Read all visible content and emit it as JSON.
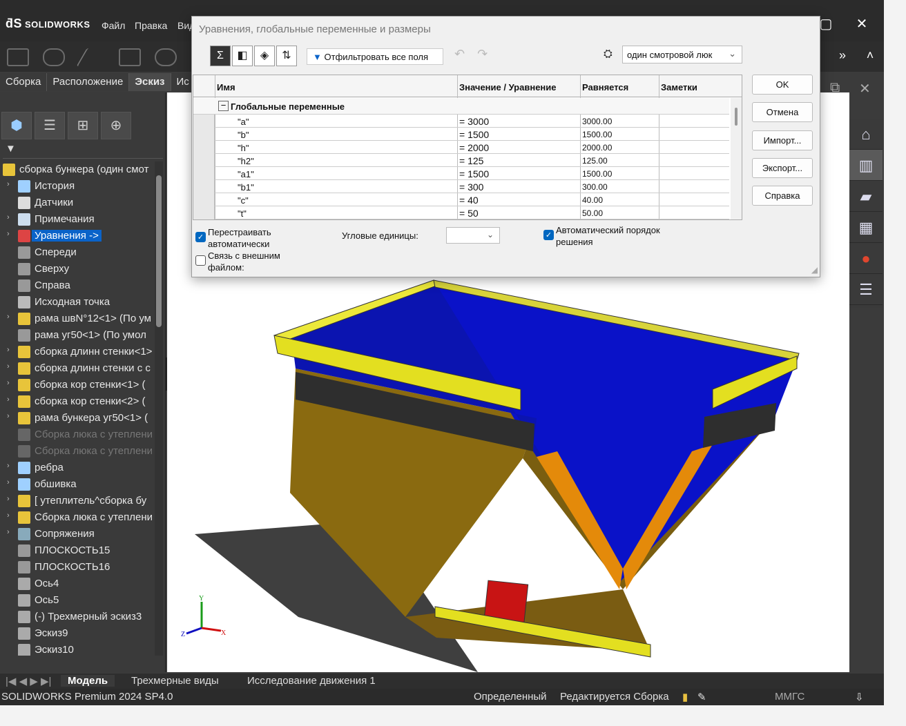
{
  "app": {
    "logo": "SOLIDWORKS",
    "menu": [
      "Файл",
      "Правка",
      "Вид"
    ],
    "tabs": [
      "Сборка",
      "Расположение",
      "Эскиз",
      "Ис"
    ],
    "active_tab": "Эскиз"
  },
  "tree": {
    "root": "сборка бункера (один смот",
    "items": [
      {
        "label": "История",
        "arrow": true,
        "icon": "history-icon"
      },
      {
        "label": "Датчики",
        "arrow": false,
        "icon": "sensor-icon"
      },
      {
        "label": "Примечания",
        "arrow": true,
        "icon": "annotation-icon"
      },
      {
        "label": "Уравнения ->",
        "arrow": true,
        "icon": "equation-icon",
        "selected": true
      },
      {
        "label": "Спереди",
        "arrow": false,
        "icon": "plane-icon"
      },
      {
        "label": "Сверху",
        "arrow": false,
        "icon": "plane-icon"
      },
      {
        "label": "Справа",
        "arrow": false,
        "icon": "plane-icon"
      },
      {
        "label": "Исходная точка",
        "arrow": false,
        "icon": "origin-icon"
      },
      {
        "label": "рама швN°12<1> (По ум",
        "arrow": true,
        "icon": "part-icon"
      },
      {
        "label": "рама уг50<1> (По умол",
        "arrow": false,
        "icon": "part-gray-icon"
      },
      {
        "label": "сборка длинн стенки<1>",
        "arrow": true,
        "icon": "assembly-icon"
      },
      {
        "label": "сборка длинн стенки с с",
        "arrow": true,
        "icon": "assembly-icon"
      },
      {
        "label": "сборка кор стенки<1> (",
        "arrow": true,
        "icon": "assembly-icon"
      },
      {
        "label": "сборка кор стенки<2> (",
        "arrow": true,
        "icon": "assembly-icon"
      },
      {
        "label": "рама бункера уг50<1> (",
        "arrow": true,
        "icon": "part-icon"
      },
      {
        "label": "Сборка люка с утеплени",
        "arrow": false,
        "icon": "assembly-dim-icon",
        "dim": true
      },
      {
        "label": "Сборка люка с утеплени",
        "arrow": false,
        "icon": "assembly-dim-icon",
        "dim": true
      },
      {
        "label": "ребра",
        "arrow": true,
        "icon": "folder-icon"
      },
      {
        "label": "обшивка",
        "arrow": true,
        "icon": "folder-icon"
      },
      {
        "label": "[ утеплитель^сборка бу",
        "arrow": true,
        "icon": "part-icon"
      },
      {
        "label": "Сборка люка с утеплени",
        "arrow": true,
        "icon": "assembly-icon"
      },
      {
        "label": "Сопряжения",
        "arrow": true,
        "icon": "mates-icon"
      },
      {
        "label": "ПЛОСКОСТЬ15",
        "arrow": false,
        "icon": "plane-icon"
      },
      {
        "label": "ПЛОСКОСТЬ16",
        "arrow": false,
        "icon": "plane-icon"
      },
      {
        "label": "Ось4",
        "arrow": false,
        "icon": "axis-icon"
      },
      {
        "label": "Ось5",
        "arrow": false,
        "icon": "axis-icon"
      },
      {
        "label": "(-) Трехмерный эскиз3",
        "arrow": false,
        "icon": "sketch3d-icon"
      },
      {
        "label": "Эскиз9",
        "arrow": false,
        "icon": "sketch-icon"
      },
      {
        "label": "Эскиз10",
        "arrow": false,
        "icon": "sketch-icon"
      }
    ]
  },
  "dialog": {
    "title": "Уравнения, глобальные переменные и размеры",
    "filter": "Отфильтровать все поля",
    "config": "один смотровой люк",
    "columns": [
      "Имя",
      "Значение / Уравнение",
      "Равняется",
      "Заметки"
    ],
    "group": "Глобальные переменные",
    "rows": [
      {
        "name": "\"a\"",
        "value": "= 3000",
        "result": "3000.00"
      },
      {
        "name": "\"b\"",
        "value": "= 1500",
        "result": "1500.00"
      },
      {
        "name": "\"h\"",
        "value": "= 2000",
        "result": "2000.00"
      },
      {
        "name": "\"h2\"",
        "value": "= 125",
        "result": "125.00"
      },
      {
        "name": "\"a1\"",
        "value": "= 1500",
        "result": "1500.00"
      },
      {
        "name": "\"b1\"",
        "value": "= 300",
        "result": "300.00"
      },
      {
        "name": "\"c\"",
        "value": "= 40",
        "result": "40.00"
      },
      {
        "name": "\"t\"",
        "value": "= 50",
        "result": "50.00"
      }
    ],
    "buttons": {
      "ok": "OK",
      "cancel": "Отмена",
      "import": "Импорт...",
      "export": "Экспорт...",
      "help": "Справка"
    },
    "rebuild_auto": "Перестраивать автоматически",
    "link_file": "Связь с внешним файлом:",
    "angular_units": "Угловые единицы:",
    "auto_order": "Автоматический порядок решения"
  },
  "bottom_tabs": [
    "Модель",
    "Трехмерные виды",
    "Исследование движения 1"
  ],
  "status": {
    "product": "SOLIDWORKS Premium 2024 SP4.0",
    "defined": "Определенный",
    "editing": "Редактируется Сборка",
    "units": "ММГС"
  }
}
